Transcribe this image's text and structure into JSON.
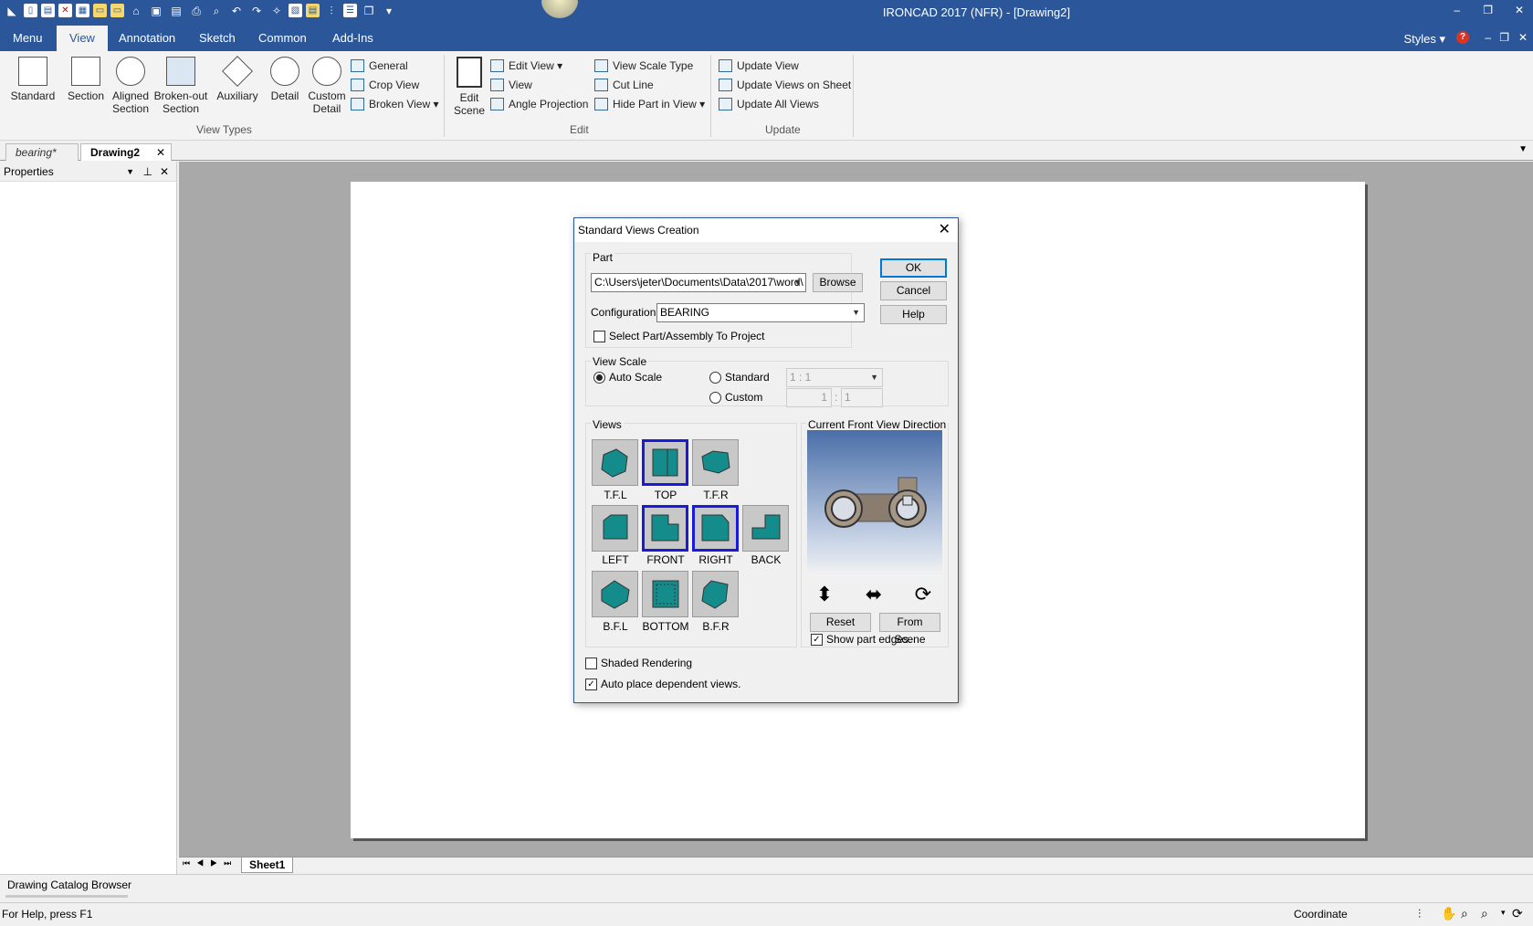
{
  "app": {
    "title": "IRONCAD 2017 (NFR) - [Drawing2]",
    "window_controls": [
      "–",
      "❐",
      "✕"
    ],
    "styles_label": "Styles",
    "mdi_controls": [
      "–",
      "❐",
      "✕"
    ]
  },
  "ribbon_tabs": [
    "Menu",
    "View",
    "Annotation",
    "Sketch",
    "Common",
    "Add-Ins"
  ],
  "ribbon": {
    "view_types": {
      "label": "View Types",
      "big": [
        "Standard",
        "Section",
        "Aligned\nSection",
        "Broken-out\nSection",
        "Auxiliary",
        "Detail",
        "Custom\nDetail"
      ],
      "small": [
        "General",
        "Crop View",
        "Broken View"
      ]
    },
    "edit": {
      "label": "Edit",
      "big": "Edit\nScene",
      "small": [
        "Edit View",
        "View",
        "Angle Projection",
        "View Scale Type",
        "Cut Line",
        "Hide Part in View"
      ]
    },
    "update": {
      "label": "Update",
      "small": [
        "Update View",
        "Update Views on Sheet",
        "Update All Views"
      ]
    }
  },
  "doc_tabs": [
    "bearing*",
    "Drawing2"
  ],
  "properties": {
    "title": "Properties"
  },
  "sheet_tab": "Sheet1",
  "catalog": "Drawing Catalog Browser",
  "status": {
    "help": "For Help, press F1",
    "coordinate": "Coordinate"
  },
  "dialog": {
    "title": "Standard Views Creation",
    "part_label": "Part",
    "part_path": "C:\\Users\\jeter\\Documents\\Data\\2017\\word\\",
    "browse": "Browse",
    "config_label": "Configuration:",
    "config_value": "BEARING",
    "select_part": "Select Part/Assembly To Project",
    "ok": "OK",
    "cancel": "Cancel",
    "help": "Help",
    "view_scale_label": "View Scale",
    "auto_scale": "Auto Scale",
    "standard": "Standard",
    "standard_value": "1 : 1",
    "custom": "Custom",
    "custom_a": "1",
    "custom_sep": ":",
    "custom_b": "1",
    "views_label": "Views",
    "views": [
      "T.F.L",
      "TOP",
      "T.F.R",
      "LEFT",
      "FRONT",
      "RIGHT",
      "BACK",
      "B.F.L",
      "BOTTOM",
      "B.F.R"
    ],
    "front_dir_label": "Current Front View Direction",
    "reset": "Reset",
    "from_scene": "From Scene",
    "show_edges": "Show part edges.",
    "shaded": "Shaded Rendering",
    "auto_place": "Auto place dependent views."
  },
  "colors": {
    "accent": "#2b579a",
    "view_fill": "#158c8c",
    "selected": "#1a1adb"
  }
}
